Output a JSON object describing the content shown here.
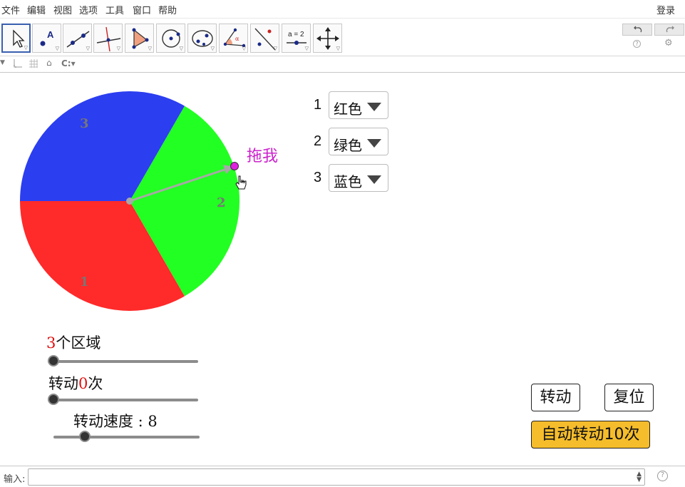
{
  "menu": {
    "items": [
      "文件",
      "编辑",
      "视图",
      "选项",
      "工具",
      "窗口",
      "帮助"
    ],
    "login": "登录"
  },
  "toolbar": {
    "tools": [
      "move-tool",
      "point-tool",
      "line-tool",
      "perpendicular-tool",
      "polygon-tool",
      "circle-tool",
      "conic-tool",
      "angle-tool",
      "reflect-tool",
      "slider-tool",
      "move-graphics-tool"
    ],
    "slider_tool_label": "a = 2"
  },
  "wheel": {
    "sector_labels": [
      "1",
      "2",
      "3"
    ],
    "colors": {
      "red": "#ff2a2a",
      "green": "#22ff22",
      "blue": "#2b3ef0"
    },
    "drag_label": "拖我"
  },
  "assignments": [
    {
      "number": "1",
      "value": "红色"
    },
    {
      "number": "2",
      "value": "绿色"
    },
    {
      "number": "3",
      "value": "蓝色"
    }
  ],
  "sliders": {
    "regions": {
      "num": "3",
      "suffix": "个区域",
      "fraction": 0.0
    },
    "spins": {
      "prefix": "转动",
      "num": "0",
      "suffix": "次",
      "fraction": 0.0
    },
    "speed": {
      "text": "转动速度 : 8",
      "fraction": 0.2
    }
  },
  "buttons": {
    "spin": "转动",
    "reset": "复位",
    "auto": "自动转动10次"
  },
  "inputbar": {
    "label": "输入:",
    "value": ""
  }
}
